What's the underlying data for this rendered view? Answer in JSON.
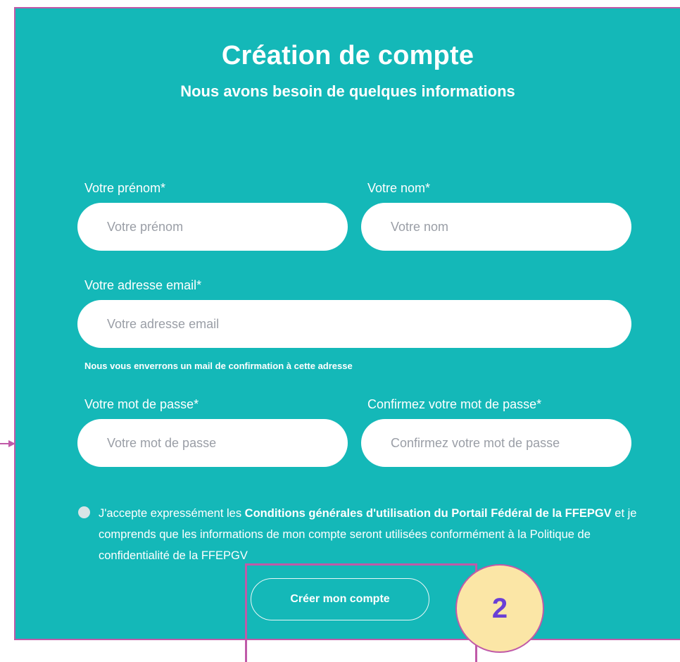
{
  "form": {
    "title": "Création de compte",
    "subtitle": "Nous avons besoin de quelques informations",
    "firstname": {
      "label": "Votre prénom*",
      "placeholder": "Votre prénom"
    },
    "lastname": {
      "label": "Votre nom*",
      "placeholder": "Votre nom"
    },
    "email": {
      "label": "Votre adresse email*",
      "placeholder": "Votre adresse email",
      "helper": "Nous vous enverrons un mail de confirmation à cette adresse"
    },
    "password": {
      "label": "Votre mot de passe*",
      "placeholder": "Votre mot de passe"
    },
    "confirm": {
      "label": "Confirmez votre mot de passe*",
      "placeholder": "Confirmez votre mot de passe"
    },
    "consent": {
      "text_a": "J'accepte expressément les ",
      "text_b": "Conditions générales d'utilisation du Portail Fédéral de la FFEPGV",
      "text_c": " et je comprends que les informations de mon compte seront utilisées conformément à la Politique de confidentialité de la FFEPGV"
    },
    "submit_label": "Créer mon compte"
  },
  "annotation": {
    "step_number": "2"
  },
  "colors": {
    "panel_bg": "#14b8b8",
    "annotation_border": "#c05aa8",
    "annotation_circle_fill": "#fbe6a6",
    "annotation_number": "#6a3fd6"
  }
}
